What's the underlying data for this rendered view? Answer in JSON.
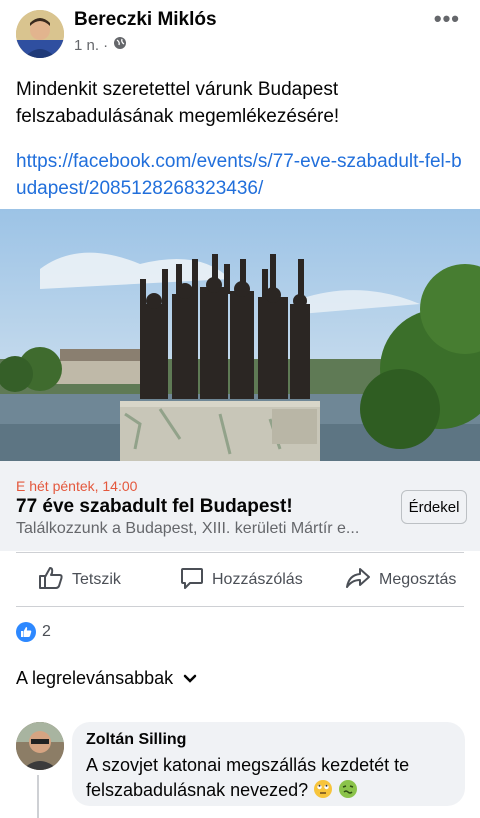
{
  "post": {
    "author": "Bereczki Miklós",
    "time": "1 n. ·",
    "text": "Mindenkit szeretettel várunk Budapest felszabadulásának megemlékezésére!",
    "link": "https://facebook.com/events/s/77-eve-szabadult-fel-budapest/2085128268323436/"
  },
  "event": {
    "date": "E hét péntek, 14:00",
    "title": "77 éve szabadult fel Budapest!",
    "location": "Találkozzunk a Budapest, XIII. kerületi Mártír e...",
    "interested_label": "Érdekel"
  },
  "actions": {
    "like": "Tetszik",
    "comment": "Hozzászólás",
    "share": "Megosztás"
  },
  "reactions": {
    "count": "2"
  },
  "comments": {
    "sort_label": "A legrelevánsabbak",
    "first": {
      "author": "Zoltán Silling",
      "text": "A szovjet katonai megszállás kezdetét te felszabadulásnak nevezed?"
    }
  },
  "colors": {
    "link": "#216fdb",
    "event_date": "#e4583d",
    "like_blue": "#2d88ff"
  }
}
